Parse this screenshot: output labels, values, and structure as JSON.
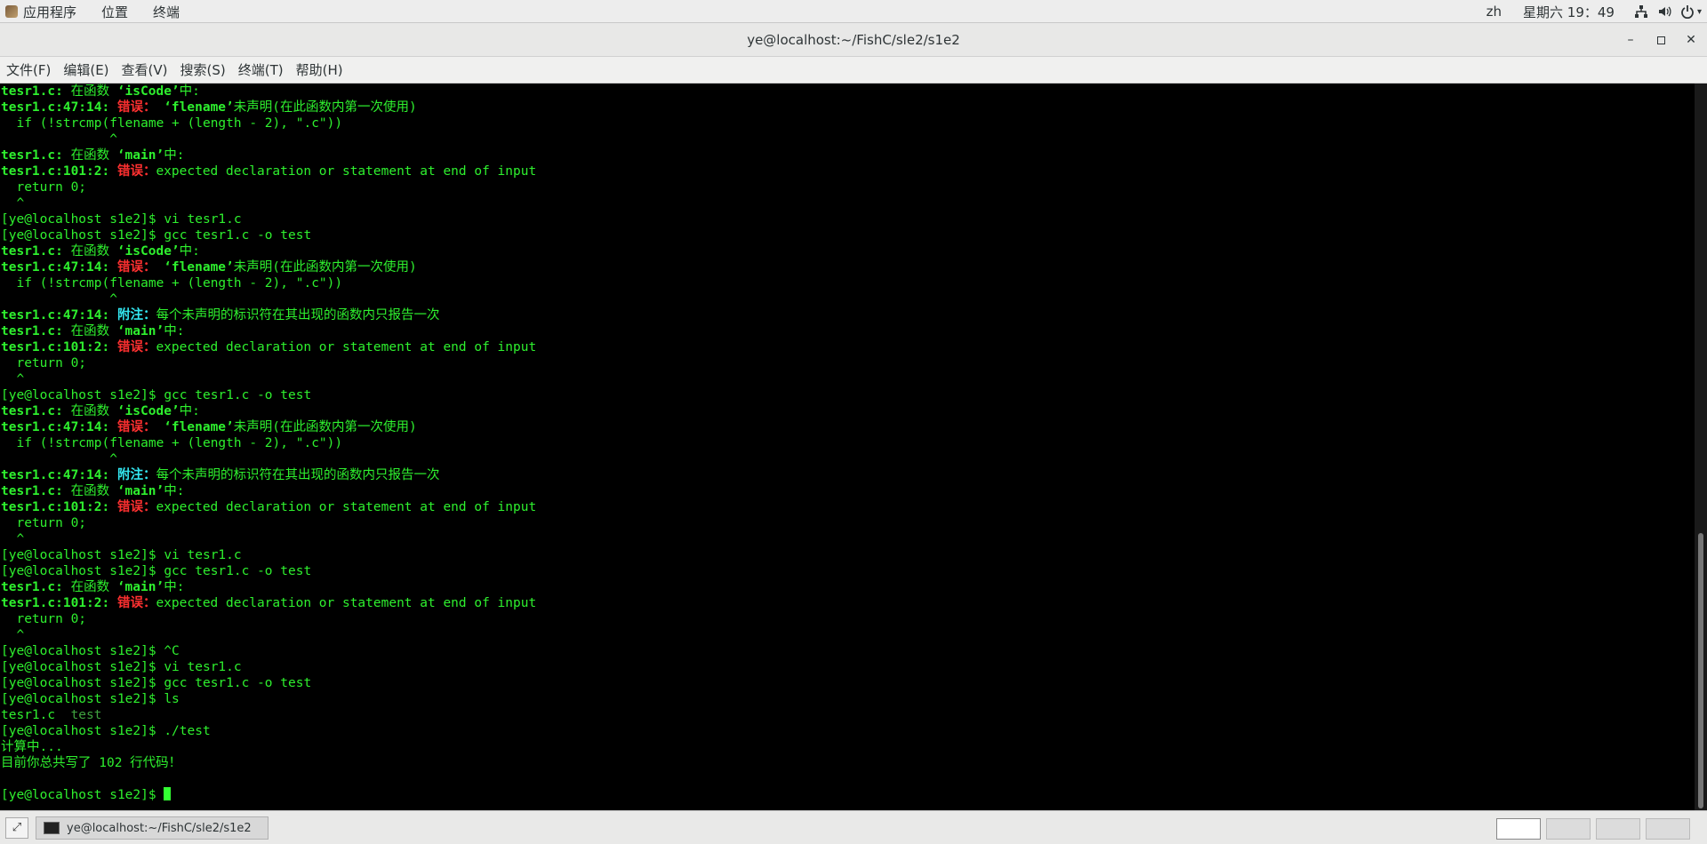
{
  "top_panel": {
    "menus": [
      "应用程序",
      "位置",
      "终端"
    ],
    "lang": "zh",
    "clock": "星期六 19：49"
  },
  "window": {
    "title": "ye@localhost:~/FishC/sle2/s1e2"
  },
  "menubar": [
    "文件(F)",
    "编辑(E)",
    "查看(V)",
    "搜索(S)",
    "终端(T)",
    "帮助(H)"
  ],
  "terminal": {
    "lines": [
      [
        [
          "gb",
          "tesr1.c: "
        ],
        [
          "g",
          "在函数 "
        ],
        [
          "gb",
          "‘isCode’"
        ],
        [
          "g",
          "中:"
        ]
      ],
      [
        [
          "gb",
          "tesr1.c:47:14: "
        ],
        [
          "r",
          "错误："
        ],
        [
          "g",
          " "
        ],
        [
          "gb",
          "‘flename’"
        ],
        [
          "g",
          "未声明(在此函数内第一次使用)"
        ]
      ],
      [
        [
          "g",
          "  if (!strcmp(flename + (length - 2), \".c\"))"
        ]
      ],
      [
        [
          "g",
          "              ^"
        ]
      ],
      [
        [
          "gb",
          "tesr1.c: "
        ],
        [
          "g",
          "在函数 "
        ],
        [
          "gb",
          "‘main’"
        ],
        [
          "g",
          "中:"
        ]
      ],
      [
        [
          "gb",
          "tesr1.c:101:2: "
        ],
        [
          "r",
          "错误："
        ],
        [
          "g",
          "expected declaration or statement at end of input"
        ]
      ],
      [
        [
          "g",
          "  return 0;"
        ]
      ],
      [
        [
          "g",
          "  ^"
        ]
      ],
      [
        [
          "g",
          "[ye@localhost s1e2]$ vi tesr1.c"
        ]
      ],
      [
        [
          "g",
          "[ye@localhost s1e2]$ gcc tesr1.c -o test"
        ]
      ],
      [
        [
          "gb",
          "tesr1.c: "
        ],
        [
          "g",
          "在函数 "
        ],
        [
          "gb",
          "‘isCode’"
        ],
        [
          "g",
          "中:"
        ]
      ],
      [
        [
          "gb",
          "tesr1.c:47:14: "
        ],
        [
          "r",
          "错误："
        ],
        [
          "g",
          " "
        ],
        [
          "gb",
          "‘flename’"
        ],
        [
          "g",
          "未声明(在此函数内第一次使用)"
        ]
      ],
      [
        [
          "g",
          "  if (!strcmp(flename + (length - 2), \".c\"))"
        ]
      ],
      [
        [
          "g",
          "              ^"
        ]
      ],
      [
        [
          "gb",
          "tesr1.c:47:14: "
        ],
        [
          "c",
          "附注："
        ],
        [
          "g",
          "每个未声明的标识符在其出现的函数内只报告一次"
        ]
      ],
      [
        [
          "gb",
          "tesr1.c: "
        ],
        [
          "g",
          "在函数 "
        ],
        [
          "gb",
          "‘main’"
        ],
        [
          "g",
          "中:"
        ]
      ],
      [
        [
          "gb",
          "tesr1.c:101:2: "
        ],
        [
          "r",
          "错误："
        ],
        [
          "g",
          "expected declaration or statement at end of input"
        ]
      ],
      [
        [
          "g",
          "  return 0;"
        ]
      ],
      [
        [
          "g",
          "  ^"
        ]
      ],
      [
        [
          "g",
          "[ye@localhost s1e2]$ gcc tesr1.c -o test"
        ]
      ],
      [
        [
          "gb",
          "tesr1.c: "
        ],
        [
          "g",
          "在函数 "
        ],
        [
          "gb",
          "‘isCode’"
        ],
        [
          "g",
          "中:"
        ]
      ],
      [
        [
          "gb",
          "tesr1.c:47:14: "
        ],
        [
          "r",
          "错误："
        ],
        [
          "g",
          " "
        ],
        [
          "gb",
          "‘flename’"
        ],
        [
          "g",
          "未声明(在此函数内第一次使用)"
        ]
      ],
      [
        [
          "g",
          "  if (!strcmp(flename + (length - 2), \".c\"))"
        ]
      ],
      [
        [
          "g",
          "              ^"
        ]
      ],
      [
        [
          "gb",
          "tesr1.c:47:14: "
        ],
        [
          "c",
          "附注："
        ],
        [
          "g",
          "每个未声明的标识符在其出现的函数内只报告一次"
        ]
      ],
      [
        [
          "gb",
          "tesr1.c: "
        ],
        [
          "g",
          "在函数 "
        ],
        [
          "gb",
          "‘main’"
        ],
        [
          "g",
          "中:"
        ]
      ],
      [
        [
          "gb",
          "tesr1.c:101:2: "
        ],
        [
          "r",
          "错误："
        ],
        [
          "g",
          "expected declaration or statement at end of input"
        ]
      ],
      [
        [
          "g",
          "  return 0;"
        ]
      ],
      [
        [
          "g",
          "  ^"
        ]
      ],
      [
        [
          "g",
          "[ye@localhost s1e2]$ vi tesr1.c"
        ]
      ],
      [
        [
          "g",
          "[ye@localhost s1e2]$ gcc tesr1.c -o test"
        ]
      ],
      [
        [
          "gb",
          "tesr1.c: "
        ],
        [
          "g",
          "在函数 "
        ],
        [
          "gb",
          "‘main’"
        ],
        [
          "g",
          "中:"
        ]
      ],
      [
        [
          "gb",
          "tesr1.c:101:2: "
        ],
        [
          "r",
          "错误："
        ],
        [
          "g",
          "expected declaration or statement at end of input"
        ]
      ],
      [
        [
          "g",
          "  return 0;"
        ]
      ],
      [
        [
          "g",
          "  ^"
        ]
      ],
      [
        [
          "g",
          "[ye@localhost s1e2]$ ^C"
        ]
      ],
      [
        [
          "g",
          "[ye@localhost s1e2]$ vi tesr1.c"
        ]
      ],
      [
        [
          "g",
          "[ye@localhost s1e2]$ gcc tesr1.c -o test"
        ]
      ],
      [
        [
          "g",
          "[ye@localhost s1e2]$ ls"
        ]
      ],
      [
        [
          "g",
          "tesr1.c  "
        ],
        [
          "dim",
          "test"
        ]
      ],
      [
        [
          "g",
          "[ye@localhost s1e2]$ ./test"
        ]
      ],
      [
        [
          "g",
          "计算中..."
        ]
      ],
      [
        [
          "g",
          "目前你总共写了 102 行代码！"
        ]
      ],
      [
        [
          "g",
          ""
        ]
      ],
      [
        [
          "g",
          "[ye@localhost s1e2]$ "
        ]
      ]
    ]
  },
  "taskbar": {
    "task_label": "ye@localhost:~/FishC/sle2/s1e2",
    "workspaces": 4,
    "active_workspace": 1
  }
}
